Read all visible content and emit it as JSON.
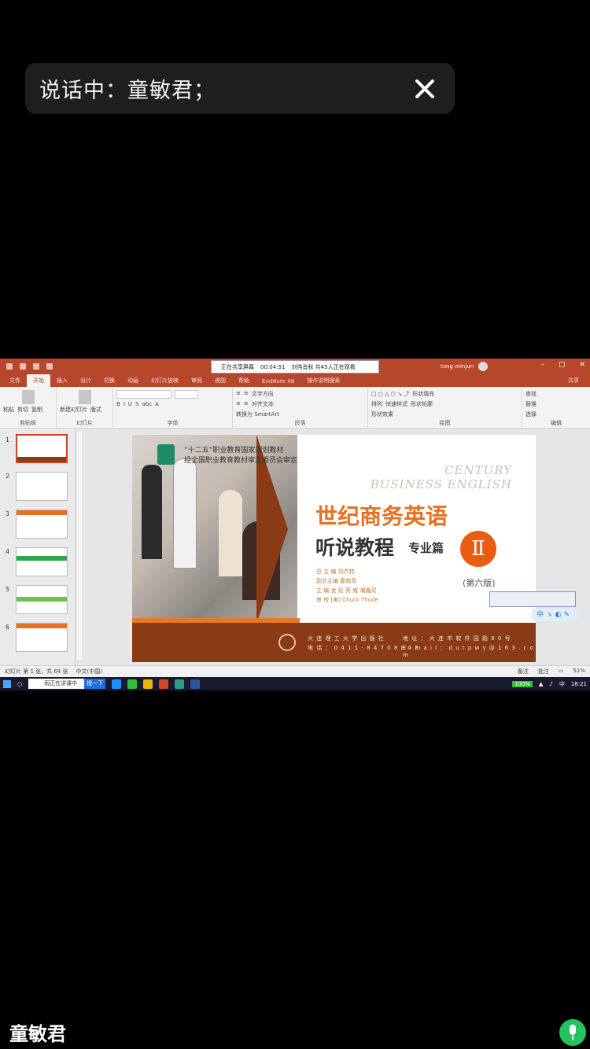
{
  "speaking": {
    "text": "说话中：童敏君；"
  },
  "screen": {
    "notice": {
      "recording": "正在共享屏幕",
      "time": "00:04:51",
      "extra": "刘伟肖秋 共45人正在观看"
    },
    "user": {
      "name": "tong minjun",
      "initials": "TM"
    },
    "tabs": [
      "文件",
      "开始",
      "插入",
      "设计",
      "切换",
      "动画",
      "幻灯片放映",
      "审阅",
      "视图",
      "帮助",
      "EndNote X8",
      "操作说明搜索"
    ],
    "share_label": "共享",
    "ribbon": {
      "clipboard": {
        "paste": "粘贴",
        "cut": "剪切",
        "copy": "复制",
        "format_painter": "格式刷",
        "label": "剪贴板"
      },
      "slides": {
        "new_slide": "新建幻灯片",
        "layout": "版式",
        "reset": "重置",
        "section": "节",
        "label": "幻灯片"
      },
      "font": {
        "label": "字体"
      },
      "paragraph": {
        "text_direction": "文字方向",
        "align_text": "对齐文本",
        "smartart": "转换为 SmartArt",
        "label": "段落"
      },
      "drawing": {
        "arrange": "排列",
        "quick_styles": "快速样式",
        "shape_fill": "形状填充",
        "shape_outline": "形状轮廓",
        "shape_effects": "形状效果",
        "label": "绘图"
      },
      "editing": {
        "find": "查找",
        "replace": "替换",
        "select": "选择",
        "label": "编辑"
      }
    },
    "slide": {
      "subtitle1": "“十二五”职业教育国家规划教材",
      "subtitle2": "经全国职业教育教材审定委员会审定",
      "century1": "CENTURY",
      "century2": "BUSINESS ENGLISH",
      "title1": "世纪商务英语",
      "title2": "听说教程",
      "title3": "专业篇",
      "roman": "Ⅱ",
      "edition": "(第六版)",
      "credits1": "总 主 编  刘杰特",
      "credits2": "副总主编  霍南青",
      "credits3": "主    编  金 廷 英 威  潮鑫双",
      "credits4": "审    校  [美] Chuck Thode",
      "footer1": "大 连 理 工 大 学 出 版 社",
      "footer2": "电 话 ： 0 4 1 1 - 8 4 7 0 8 8 4 2",
      "footer3": "地 址 ： 大 连 市 软 件 园 路 8 0 号",
      "footer4": "E - m a i l ： d u t p w y @ 1 6 3 . c o m"
    },
    "status": {
      "slide_info": "幻灯片 第 1 张，共 64 张",
      "language": "中文(中国)",
      "notes": "备注",
      "comments": "批注",
      "zoom": "51%"
    },
    "taskbar": {
      "search_text": "雨正在讲课中",
      "search_go": "搜一下",
      "battery": "100%",
      "time": "18:21"
    }
  },
  "caller_name": "童敏君"
}
